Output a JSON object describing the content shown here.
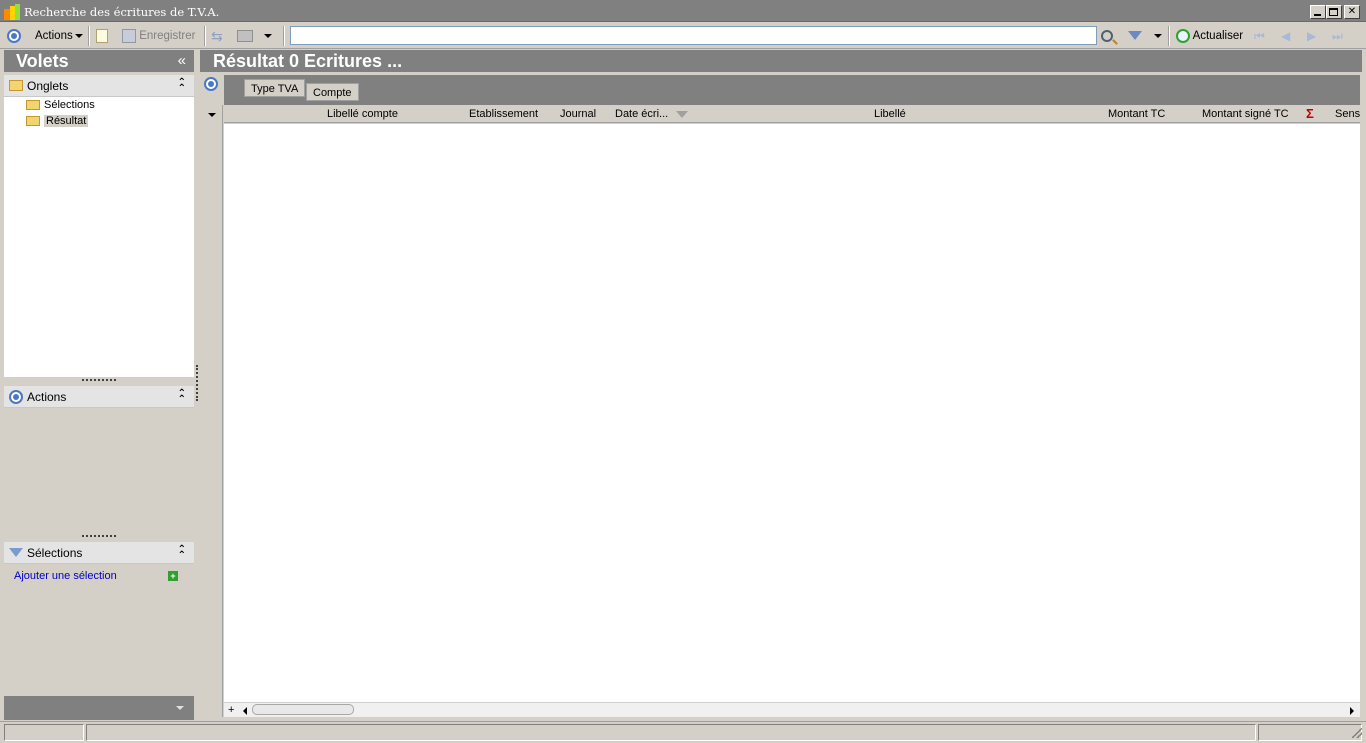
{
  "window": {
    "title": "Recherche des écritures de T.V.A."
  },
  "toolbar": {
    "actions_label": "Actions",
    "save_label": "Enregistrer",
    "search_value": "",
    "refresh_label": "Actualiser"
  },
  "left": {
    "header": "Volets",
    "collapse_glyph": "«",
    "onglets": {
      "label": "Onglets",
      "items": [
        {
          "label": "Sélections"
        },
        {
          "label": "Résultat"
        }
      ]
    },
    "actions": {
      "label": "Actions"
    },
    "selections": {
      "label": "Sélections",
      "add_link": "Ajouter une sélection"
    }
  },
  "main": {
    "title": "Résultat 0 Ecritures  ...",
    "group_tabs": [
      "Type TVA",
      "Compte"
    ],
    "columns": [
      "Libellé compte",
      "Etablissement",
      "Journal",
      "Date écri...",
      "Libellé",
      "Montant TC",
      "Montant signé TC",
      "Σ",
      "Sens"
    ]
  },
  "colors": {
    "header_grey": "#808080",
    "panel_bg": "#d4d0c8",
    "link_blue": "#0000c8",
    "sigma_red": "#c00000"
  }
}
